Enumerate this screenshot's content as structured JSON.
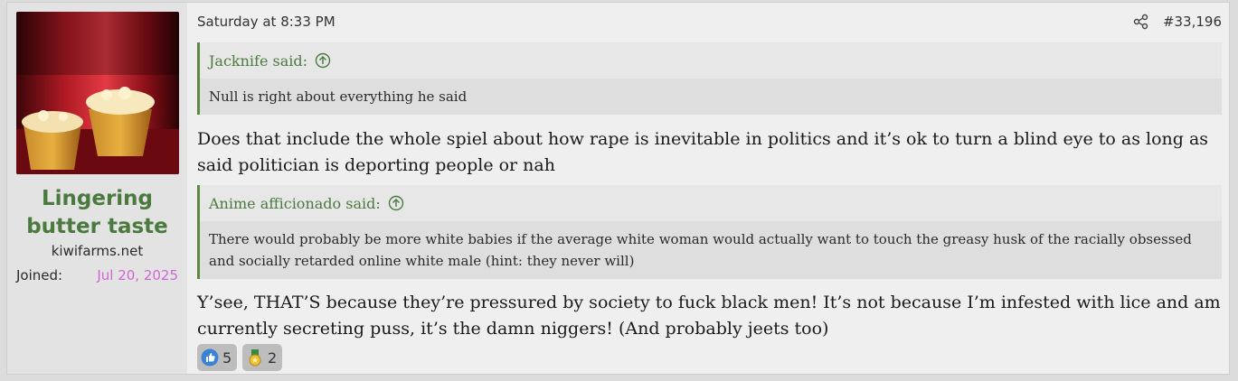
{
  "user": {
    "name": "Lingering butter taste",
    "title": "kiwifarms.net",
    "joined_label": "Joined:",
    "joined_value": "Jul 20, 2025"
  },
  "post": {
    "timestamp": "Saturday at 8:33 PM",
    "number": "#33,196",
    "quote1": {
      "author": "Jacknife said:",
      "text": "Null is right about everything he said"
    },
    "reply1": "Does that include the whole spiel about how rape is inevitable in politics and it’s ok to turn a blind eye to as long as said politician is deporting people or nah",
    "quote2": {
      "author": "Anime afficionado said:",
      "text": "There would probably be more white babies if the average white woman would actually want to touch the greasy husk of the racially obsessed and socially retarded online white male (hint: they never will)"
    },
    "reply2": "Y’see, THAT’S because they’re pressured by society to fuck black men! It’s not because I’m infested with lice and am currently secreting puss, it’s the damn niggers! (And probably jeets too)"
  },
  "reactions": [
    {
      "icon": "thumbs-up-icon",
      "count": "5"
    },
    {
      "icon": "medal-icon",
      "count": "2"
    }
  ],
  "colors": {
    "username": "#4a7a3e",
    "quote_border": "#5b8a45",
    "joined": "#d066d6"
  }
}
